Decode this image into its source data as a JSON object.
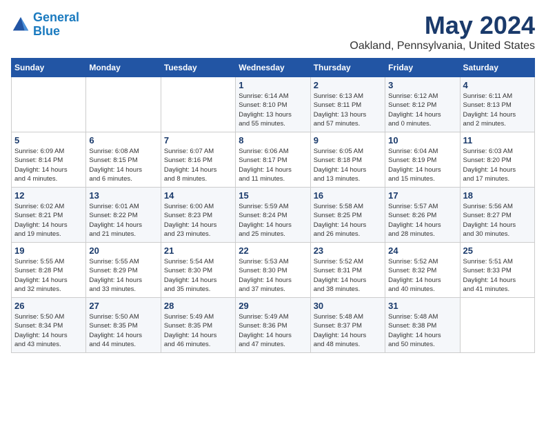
{
  "header": {
    "logo_line1": "General",
    "logo_line2": "Blue",
    "month_title": "May 2024",
    "location": "Oakland, Pennsylvania, United States"
  },
  "days_of_week": [
    "Sunday",
    "Monday",
    "Tuesday",
    "Wednesday",
    "Thursday",
    "Friday",
    "Saturday"
  ],
  "weeks": [
    [
      {
        "day": "",
        "info": ""
      },
      {
        "day": "",
        "info": ""
      },
      {
        "day": "",
        "info": ""
      },
      {
        "day": "1",
        "info": "Sunrise: 6:14 AM\nSunset: 8:10 PM\nDaylight: 13 hours\nand 55 minutes."
      },
      {
        "day": "2",
        "info": "Sunrise: 6:13 AM\nSunset: 8:11 PM\nDaylight: 13 hours\nand 57 minutes."
      },
      {
        "day": "3",
        "info": "Sunrise: 6:12 AM\nSunset: 8:12 PM\nDaylight: 14 hours\nand 0 minutes."
      },
      {
        "day": "4",
        "info": "Sunrise: 6:11 AM\nSunset: 8:13 PM\nDaylight: 14 hours\nand 2 minutes."
      }
    ],
    [
      {
        "day": "5",
        "info": "Sunrise: 6:09 AM\nSunset: 8:14 PM\nDaylight: 14 hours\nand 4 minutes."
      },
      {
        "day": "6",
        "info": "Sunrise: 6:08 AM\nSunset: 8:15 PM\nDaylight: 14 hours\nand 6 minutes."
      },
      {
        "day": "7",
        "info": "Sunrise: 6:07 AM\nSunset: 8:16 PM\nDaylight: 14 hours\nand 8 minutes."
      },
      {
        "day": "8",
        "info": "Sunrise: 6:06 AM\nSunset: 8:17 PM\nDaylight: 14 hours\nand 11 minutes."
      },
      {
        "day": "9",
        "info": "Sunrise: 6:05 AM\nSunset: 8:18 PM\nDaylight: 14 hours\nand 13 minutes."
      },
      {
        "day": "10",
        "info": "Sunrise: 6:04 AM\nSunset: 8:19 PM\nDaylight: 14 hours\nand 15 minutes."
      },
      {
        "day": "11",
        "info": "Sunrise: 6:03 AM\nSunset: 8:20 PM\nDaylight: 14 hours\nand 17 minutes."
      }
    ],
    [
      {
        "day": "12",
        "info": "Sunrise: 6:02 AM\nSunset: 8:21 PM\nDaylight: 14 hours\nand 19 minutes."
      },
      {
        "day": "13",
        "info": "Sunrise: 6:01 AM\nSunset: 8:22 PM\nDaylight: 14 hours\nand 21 minutes."
      },
      {
        "day": "14",
        "info": "Sunrise: 6:00 AM\nSunset: 8:23 PM\nDaylight: 14 hours\nand 23 minutes."
      },
      {
        "day": "15",
        "info": "Sunrise: 5:59 AM\nSunset: 8:24 PM\nDaylight: 14 hours\nand 25 minutes."
      },
      {
        "day": "16",
        "info": "Sunrise: 5:58 AM\nSunset: 8:25 PM\nDaylight: 14 hours\nand 26 minutes."
      },
      {
        "day": "17",
        "info": "Sunrise: 5:57 AM\nSunset: 8:26 PM\nDaylight: 14 hours\nand 28 minutes."
      },
      {
        "day": "18",
        "info": "Sunrise: 5:56 AM\nSunset: 8:27 PM\nDaylight: 14 hours\nand 30 minutes."
      }
    ],
    [
      {
        "day": "19",
        "info": "Sunrise: 5:55 AM\nSunset: 8:28 PM\nDaylight: 14 hours\nand 32 minutes."
      },
      {
        "day": "20",
        "info": "Sunrise: 5:55 AM\nSunset: 8:29 PM\nDaylight: 14 hours\nand 33 minutes."
      },
      {
        "day": "21",
        "info": "Sunrise: 5:54 AM\nSunset: 8:30 PM\nDaylight: 14 hours\nand 35 minutes."
      },
      {
        "day": "22",
        "info": "Sunrise: 5:53 AM\nSunset: 8:30 PM\nDaylight: 14 hours\nand 37 minutes."
      },
      {
        "day": "23",
        "info": "Sunrise: 5:52 AM\nSunset: 8:31 PM\nDaylight: 14 hours\nand 38 minutes."
      },
      {
        "day": "24",
        "info": "Sunrise: 5:52 AM\nSunset: 8:32 PM\nDaylight: 14 hours\nand 40 minutes."
      },
      {
        "day": "25",
        "info": "Sunrise: 5:51 AM\nSunset: 8:33 PM\nDaylight: 14 hours\nand 41 minutes."
      }
    ],
    [
      {
        "day": "26",
        "info": "Sunrise: 5:50 AM\nSunset: 8:34 PM\nDaylight: 14 hours\nand 43 minutes."
      },
      {
        "day": "27",
        "info": "Sunrise: 5:50 AM\nSunset: 8:35 PM\nDaylight: 14 hours\nand 44 minutes."
      },
      {
        "day": "28",
        "info": "Sunrise: 5:49 AM\nSunset: 8:35 PM\nDaylight: 14 hours\nand 46 minutes."
      },
      {
        "day": "29",
        "info": "Sunrise: 5:49 AM\nSunset: 8:36 PM\nDaylight: 14 hours\nand 47 minutes."
      },
      {
        "day": "30",
        "info": "Sunrise: 5:48 AM\nSunset: 8:37 PM\nDaylight: 14 hours\nand 48 minutes."
      },
      {
        "day": "31",
        "info": "Sunrise: 5:48 AM\nSunset: 8:38 PM\nDaylight: 14 hours\nand 50 minutes."
      },
      {
        "day": "",
        "info": ""
      }
    ]
  ]
}
